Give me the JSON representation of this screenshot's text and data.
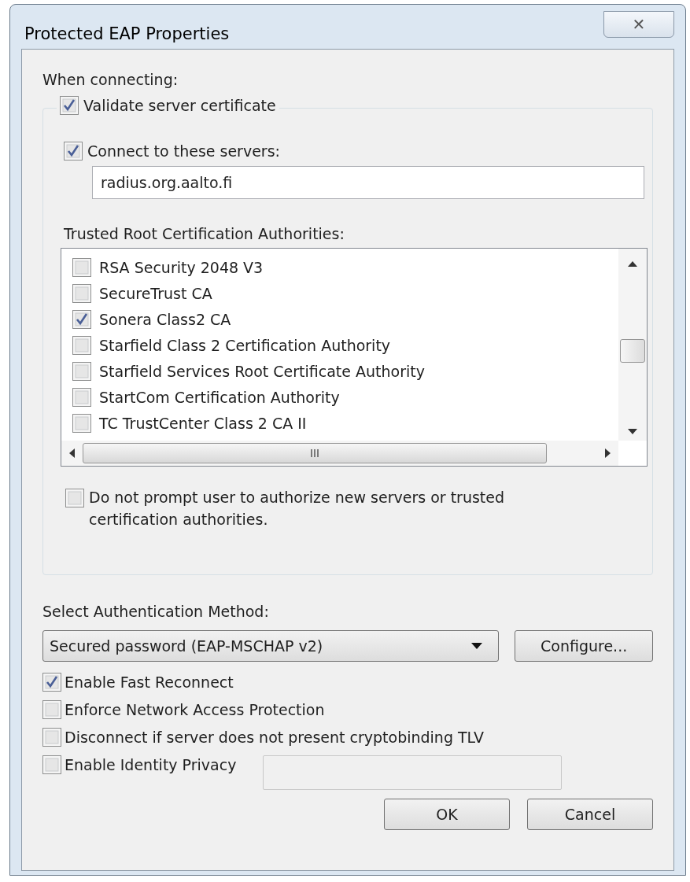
{
  "window": {
    "title": "Protected EAP Properties",
    "close_glyph": "✕"
  },
  "when_connecting_label": "When connecting:",
  "validate_server_certificate": {
    "label": "Validate server certificate",
    "checked": true
  },
  "connect_to_servers": {
    "label": "Connect to these servers:",
    "checked": true,
    "value": "radius.org.aalto.fi"
  },
  "trusted_root_label": "Trusted Root Certification Authorities:",
  "authorities": [
    {
      "label": "RSA Security 2048 V3",
      "checked": false
    },
    {
      "label": "SecureTrust CA",
      "checked": false
    },
    {
      "label": "Sonera Class2 CA",
      "checked": true
    },
    {
      "label": "Starfield Class 2 Certification Authority",
      "checked": false
    },
    {
      "label": "Starfield Services Root Certificate Authority",
      "checked": false
    },
    {
      "label": "StartCom Certification Authority",
      "checked": false
    },
    {
      "label": "TC TrustCenter Class 2 CA II",
      "checked": false
    }
  ],
  "do_not_prompt": {
    "label": "Do not prompt user to authorize new servers or trusted certification authorities.",
    "checked": false
  },
  "auth_method_label": "Select Authentication Method:",
  "auth_method": {
    "value": "Secured password (EAP-MSCHAP v2)"
  },
  "configure_button": "Configure...",
  "options": [
    {
      "label": "Enable Fast Reconnect",
      "checked": true
    },
    {
      "label": "Enforce Network Access Protection",
      "checked": false
    },
    {
      "label": "Disconnect if server does not present cryptobinding TLV",
      "checked": false
    },
    {
      "label": "Enable Identity Privacy",
      "checked": false,
      "has_field": true
    }
  ],
  "buttons": [
    "OK",
    "Cancel"
  ]
}
